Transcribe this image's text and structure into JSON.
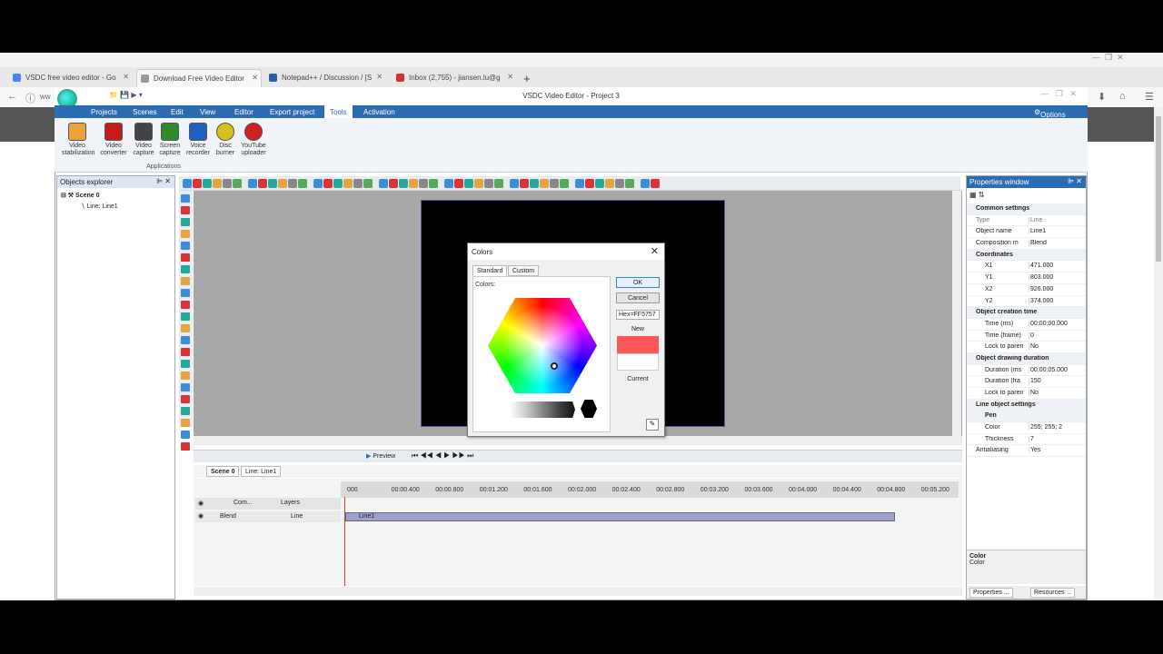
{
  "browser": {
    "tabs": [
      {
        "title": "VSDC free video editor - Go",
        "color": "#4285f4"
      },
      {
        "title": "Download Free Video Editor",
        "color": "#777777"
      },
      {
        "title": "Notepad++ / Discussion / [S",
        "color": "#2563a8"
      },
      {
        "title": "Inbox (2,755) - jiansen.lu@g",
        "color": "#d93025"
      }
    ],
    "address_fragment": "ww"
  },
  "app": {
    "title": "VSDC Video Editor - Project 3",
    "menu": [
      "Projects",
      "Scenes",
      "Edit",
      "View",
      "Editor",
      "Export project",
      "Tools",
      "Activation"
    ],
    "active_menu": "Tools",
    "options_label": "Options",
    "ribbon_group": "Applications",
    "ribbon": [
      {
        "line1": "Video",
        "line2": "stabilization",
        "color": "#e8a43a"
      },
      {
        "line1": "Video",
        "line2": "converter",
        "color": "#c51b1b"
      },
      {
        "line1": "Video",
        "line2": "capture",
        "color": "#444444"
      },
      {
        "line1": "Screen",
        "line2": "capture",
        "color": "#2e8b2e"
      },
      {
        "line1": "Voice",
        "line2": "recorder",
        "color": "#1f5fbf"
      },
      {
        "line1": "Disc",
        "line2": "burner",
        "color": "#d7c21b"
      },
      {
        "line1": "YouTube",
        "line2": "uploader",
        "color": "#d02020"
      }
    ]
  },
  "objects_explorer": {
    "title": "Objects explorer",
    "scene": "Scene 0",
    "child": "Line: Line1"
  },
  "colors_dialog": {
    "title": "Colors",
    "tabs": [
      "Standard",
      "Custom"
    ],
    "colors_label": "Colors:",
    "ok": "OK",
    "cancel": "Cancel",
    "hex": "Hex=FF5757",
    "new_label": "New",
    "current_label": "Current",
    "new_color": "#ff5757",
    "current_color": "#ffffff"
  },
  "timeline": {
    "preview_label": "Preview",
    "tabs": [
      "Scene 0",
      "Line: Line1"
    ],
    "ticks": [
      "000",
      "00:00.400",
      "00:00.800",
      "00:01.200",
      "00:01.600",
      "00:02.000",
      "00:02.400",
      "00:02.800",
      "00:03.200",
      "00:03.600",
      "00:04.000",
      "00:04.400",
      "00:04.800",
      "00:05.200"
    ],
    "layer_header": {
      "com": "Com...",
      "layers": "Layers"
    },
    "layer_row": {
      "blend": "Blend",
      "name": "Line"
    },
    "clip": "Line1"
  },
  "properties": {
    "title": "Properties window",
    "rows": [
      {
        "k": "Common settings",
        "v": "",
        "kind": "sec"
      },
      {
        "k": "Type",
        "v": "Line",
        "kind": "mute"
      },
      {
        "k": "Object name",
        "v": "Line1",
        "kind": ""
      },
      {
        "k": "Composition m",
        "v": "Blend",
        "kind": ""
      },
      {
        "k": "Coordinates",
        "v": "",
        "kind": "sec"
      },
      {
        "k": "X1",
        "v": "471.000",
        "kind": "sub"
      },
      {
        "k": "Y1",
        "v": "803.000",
        "kind": "sub"
      },
      {
        "k": "X2",
        "v": "926.000",
        "kind": "sub"
      },
      {
        "k": "Y2",
        "v": "374.000",
        "kind": "sub"
      },
      {
        "k": "Object creation time",
        "v": "",
        "kind": "sec"
      },
      {
        "k": "Time (ms)",
        "v": "00:00:00.000",
        "kind": "sub"
      },
      {
        "k": "Time (frame)",
        "v": "0",
        "kind": "sub"
      },
      {
        "k": "Lock to paren",
        "v": "No",
        "kind": "sub"
      },
      {
        "k": "Object drawing duration",
        "v": "",
        "kind": "sec"
      },
      {
        "k": "Duration (ms",
        "v": "00:00:05.000",
        "kind": "sub"
      },
      {
        "k": "Duration (fra",
        "v": "150",
        "kind": "sub"
      },
      {
        "k": "Lock to paren",
        "v": "No",
        "kind": "sub"
      },
      {
        "k": "Line object settings",
        "v": "",
        "kind": "sec"
      },
      {
        "k": "Pen",
        "v": "",
        "kind": "sec sub"
      },
      {
        "k": "Color",
        "v": "255; 255; 2",
        "kind": "sub"
      },
      {
        "k": "Thickness",
        "v": "7",
        "kind": "sub"
      },
      {
        "k": "Antialiasing",
        "v": "Yes",
        "kind": ""
      }
    ],
    "desc_title": "Color",
    "desc_text": "Color",
    "bottom_tabs": [
      "Properties ...",
      "Resources ..."
    ]
  }
}
